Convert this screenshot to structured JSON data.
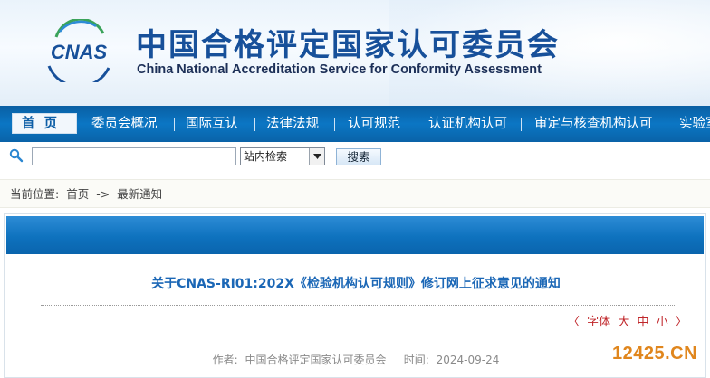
{
  "header": {
    "logo_text": "CNAS",
    "title_cn": "中国合格评定国家认可委员会",
    "title_en": "China National Accreditation Service for Conformity Assessment"
  },
  "nav": {
    "items": [
      {
        "label": "首页",
        "active": true
      },
      {
        "label": "委员会概况"
      },
      {
        "label": "国际互认"
      },
      {
        "label": "法律法规"
      },
      {
        "label": "认可规范"
      },
      {
        "label": "认证机构认可"
      },
      {
        "label": "审定与核查机构认可"
      },
      {
        "label": "实验室"
      }
    ]
  },
  "search": {
    "input_value": "",
    "scope_selected": "站内检索",
    "button_label": "搜索"
  },
  "breadcrumb": {
    "prefix": "当前位置:",
    "home": "首页",
    "arrow": "->",
    "current": "最新通知"
  },
  "article": {
    "title": "关于CNAS-RI01:202X《检验机构认可规则》修订网上征求意见的通知",
    "font_size_controls": {
      "open": "〈",
      "label": "字体",
      "large": "大",
      "medium": "中",
      "small": "小",
      "close": "〉"
    },
    "meta": {
      "author_label": "作者:",
      "author": "中国合格评定国家认可委员会",
      "time_label": "时间:",
      "time": "2024-09-24"
    }
  },
  "watermark": "12425.CN",
  "colors": {
    "brand_blue": "#17509a",
    "nav_blue": "#0b76c4",
    "title_blue": "#1b67b6",
    "accent_red": "#c0262a",
    "watermark_orange": "#e0861d"
  }
}
